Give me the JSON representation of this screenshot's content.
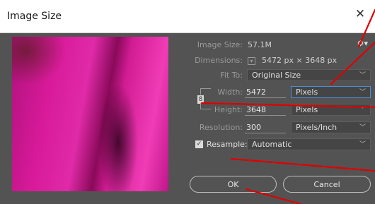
{
  "window": {
    "title": "Image Size",
    "close_glyph": "✕"
  },
  "info": {
    "image_size_label": "Image Size:",
    "image_size_value": "57.1M",
    "dimensions_label": "Dimensions:",
    "dimensions_value": "5472 px  ×  3648 px"
  },
  "fit_to": {
    "label": "Fit To:",
    "value": "Original Size"
  },
  "width": {
    "label": "Width:",
    "value": "5472",
    "unit": "Pixels"
  },
  "height": {
    "label": "Height:",
    "value": "3648",
    "unit": "Pixels"
  },
  "resolution": {
    "label": "Resolution:",
    "value": "300",
    "unit": "Pixels/Inch"
  },
  "resample": {
    "label": "Resample:",
    "value": "Automatic",
    "checked": true
  },
  "buttons": {
    "ok": "OK",
    "cancel": "Cancel"
  },
  "icons": {
    "close": "close-icon",
    "gear": "gear-icon",
    "dimensions_menu": "chevron-down-icon",
    "constrain": "link-icon",
    "checkbox": "checkmark-icon"
  },
  "colors": {
    "dialog_bg": "#535353",
    "annotation": "#e00000",
    "active_border": "#4a8fd8"
  }
}
